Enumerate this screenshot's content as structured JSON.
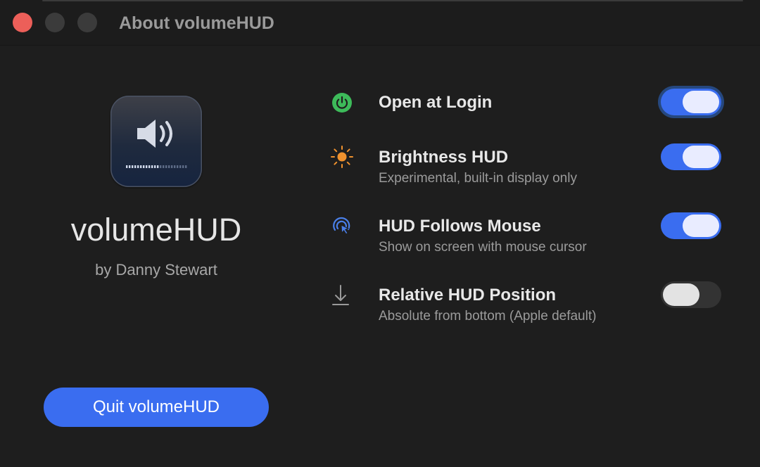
{
  "window": {
    "title": "About volumeHUD",
    "buttons": [
      "close",
      "minimize",
      "zoom"
    ]
  },
  "app": {
    "icon": "speaker-volume-icon",
    "name": "volumeHUD",
    "author": "by Danny Stewart"
  },
  "settings": [
    {
      "icon": "power-icon",
      "icon_color": "#3dbb5a",
      "title": "Open at Login",
      "subtitle": "",
      "enabled": true,
      "focused": true
    },
    {
      "icon": "sun-icon",
      "icon_color": "#f0922e",
      "title": "Brightness HUD",
      "subtitle": "Experimental, built-in display only",
      "enabled": true,
      "focused": false
    },
    {
      "icon": "cursor-click-icon",
      "icon_color": "#4a7fe8",
      "title": "HUD Follows Mouse",
      "subtitle": "Show on screen with mouse cursor",
      "enabled": true,
      "focused": false
    },
    {
      "icon": "arrow-down-to-line-icon",
      "icon_color": "#9a9a9a",
      "title": "Relative HUD Position",
      "subtitle": "Absolute from bottom (Apple default)",
      "enabled": false,
      "focused": false
    }
  ],
  "quit_button": {
    "label": "Quit volumeHUD"
  },
  "colors": {
    "accent": "#3a6df0",
    "background": "#1e1e1e",
    "close": "#ec5f59"
  }
}
